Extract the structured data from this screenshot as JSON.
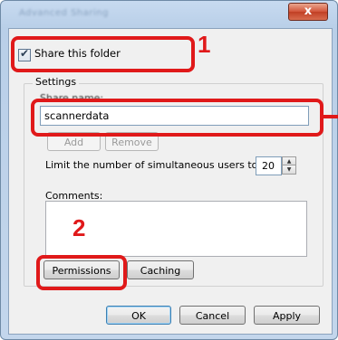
{
  "window": {
    "title": "Advanced Sharing",
    "close_label": "x"
  },
  "share": {
    "checkbox_label": "Share this folder",
    "checked": true
  },
  "settings": {
    "legend": "Settings",
    "share_name_label": "Share name:",
    "share_name_value": "scannerdata",
    "add_label": "Add",
    "remove_label": "Remove",
    "limit_label": "Limit the number of simultaneous users to:",
    "limit_value": "20",
    "comments_label": "Comments:",
    "comments_value": "",
    "permissions_label": "Permissions",
    "caching_label": "Caching"
  },
  "footer": {
    "ok_label": "OK",
    "cancel_label": "Cancel",
    "apply_label": "Apply"
  },
  "annotations": {
    "step1": "1",
    "step2": "2",
    "highlight_color": "#e0191a"
  },
  "icons": {
    "checkbox": "checkmark-icon",
    "spin_up": "arrow-up-icon",
    "spin_down": "arrow-down-icon",
    "close": "close-icon"
  }
}
